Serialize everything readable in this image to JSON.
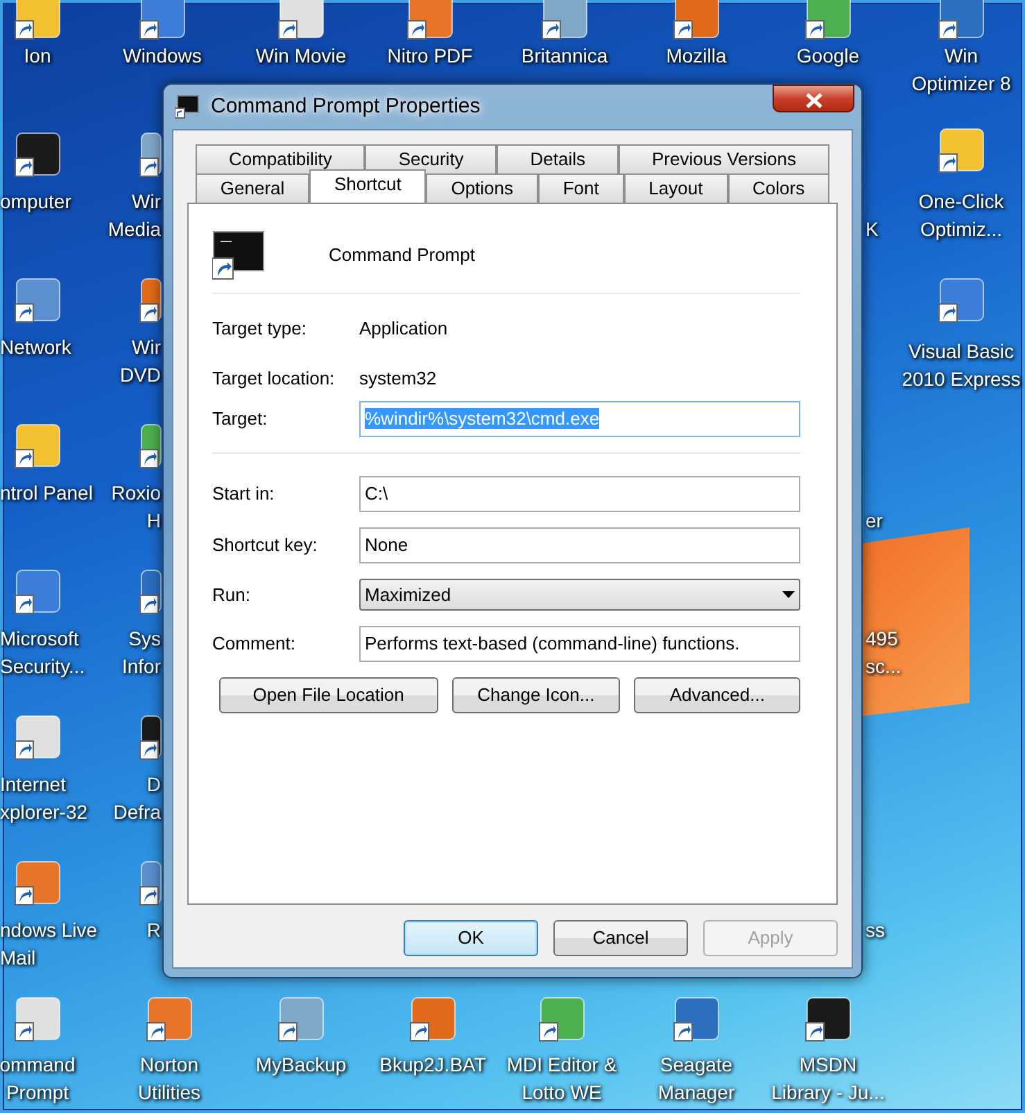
{
  "desktop": {
    "top_row": [
      {
        "lines": [
          "Ion"
        ]
      },
      {
        "lines": [
          "Windows"
        ]
      },
      {
        "lines": [
          "Win Movie"
        ]
      },
      {
        "lines": [
          "Nitro PDF"
        ]
      },
      {
        "lines": [
          "Britannica"
        ]
      },
      {
        "lines": [
          "Mozilla"
        ]
      },
      {
        "lines": [
          "Google"
        ]
      },
      {
        "lines": [
          "Win",
          "Optimizer 8"
        ]
      }
    ],
    "left_column": [
      {
        "lines": [
          "omputer"
        ]
      },
      {
        "lines": [
          "Network"
        ]
      },
      {
        "lines": [
          "ntrol Panel"
        ]
      },
      {
        "lines": [
          "Microsoft",
          "Security..."
        ]
      },
      {
        "lines": [
          "Internet",
          "xplorer-32"
        ]
      },
      {
        "lines": [
          "ndows Live",
          "Mail"
        ]
      }
    ],
    "second_column": [
      {
        "lines": [
          "Wir",
          "Media"
        ]
      },
      {
        "lines": [
          "Wir",
          "DVD"
        ]
      },
      {
        "lines": [
          "Roxio",
          "H"
        ]
      },
      {
        "lines": [
          "Sys",
          "Infor"
        ]
      },
      {
        "lines": [
          "D",
          "Defra"
        ]
      },
      {
        "lines": [
          "R"
        ]
      }
    ],
    "behind_dialog_right": [
      {
        "lines": [
          "K"
        ]
      },
      {
        "lines": [
          "er"
        ]
      },
      {
        "lines": [
          "495",
          "sc..."
        ]
      },
      {
        "lines": [
          "ss"
        ]
      }
    ],
    "right_column": [
      {
        "lines": [
          "One-Click",
          "Optimiz..."
        ]
      },
      {
        "lines": [
          "Visual Basic",
          "2010 Express"
        ]
      }
    ],
    "bottom_row": [
      {
        "lines": [
          "ommand",
          "Prompt"
        ]
      },
      {
        "lines": [
          "Norton",
          "Utilities"
        ]
      },
      {
        "lines": [
          "MyBackup"
        ]
      },
      {
        "lines": [
          "Bkup2J.BAT"
        ]
      },
      {
        "lines": [
          "MDI Editor &",
          "Lotto WE"
        ]
      },
      {
        "lines": [
          "Seagate",
          "Manager"
        ]
      },
      {
        "lines": [
          "MSDN",
          "Library - Ju..."
        ]
      }
    ]
  },
  "dialog": {
    "title": "Command Prompt Properties",
    "tab_rows": [
      [
        {
          "label": "Compatibility",
          "selected": false
        },
        {
          "label": "Security",
          "selected": false
        },
        {
          "label": "Details",
          "selected": false
        },
        {
          "label": "Previous Versions",
          "selected": false
        }
      ],
      [
        {
          "label": "General",
          "selected": false
        },
        {
          "label": "Shortcut",
          "selected": true
        },
        {
          "label": "Options",
          "selected": false
        },
        {
          "label": "Font",
          "selected": false
        },
        {
          "label": "Layout",
          "selected": false
        },
        {
          "label": "Colors",
          "selected": false
        }
      ]
    ],
    "shortcut_name": "Command Prompt",
    "info": [
      {
        "label": "Target type:",
        "value": "Application"
      },
      {
        "label": "Target location:",
        "value": "system32"
      }
    ],
    "target": {
      "label": "Target:",
      "value": "%windir%\\system32\\cmd.exe",
      "text_selected": true
    },
    "fields": [
      {
        "kind": "text",
        "label": "Start in:",
        "value": "C:\\"
      },
      {
        "kind": "text",
        "label": "Shortcut key:",
        "value": "None"
      },
      {
        "kind": "dropdown",
        "label": "Run:",
        "value": "Maximized"
      },
      {
        "kind": "text",
        "label": "Comment:",
        "value": "Performs text-based (command-line) functions."
      }
    ],
    "action_buttons": [
      {
        "label": "Open File Location"
      },
      {
        "label": "Change Icon..."
      },
      {
        "label": "Advanced..."
      }
    ],
    "footer_buttons": [
      {
        "label": "OK",
        "default": true,
        "disabled": false
      },
      {
        "label": "Cancel",
        "default": false,
        "disabled": false
      },
      {
        "label": "Apply",
        "default": false,
        "disabled": true
      }
    ]
  }
}
